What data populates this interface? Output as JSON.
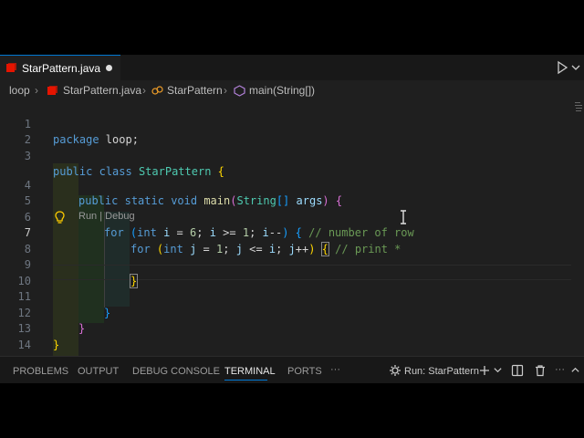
{
  "tab": {
    "filename": "StarPattern.java"
  },
  "breadcrumb": {
    "folder": "loop",
    "file": "StarPattern.java",
    "class": "StarPattern",
    "method": "main(String[])"
  },
  "codelens": "Run | Debug",
  "line_numbers": [
    "1",
    "2",
    "3",
    "4",
    "5",
    "6",
    "7",
    "8",
    "9",
    "10",
    "11",
    "12",
    "13",
    "14"
  ],
  "code": {
    "l1_kw": "package",
    "l1_rest": " loop;",
    "l3_kw1": "public",
    "l3_kw2": "class",
    "l3_name": "StarPattern",
    "l3_brace": "{",
    "l4_kw1": "public",
    "l4_kw2": "static",
    "l4_kw3": "void",
    "l4_fn": "main",
    "l4_paren_open": "(",
    "l4_type": "String",
    "l4_arr": "[]",
    "l4_arg": "args",
    "l4_paren_close": ")",
    "l4_brace": "{",
    "l6_for": "for",
    "l6_open": "(",
    "l6_int": "int",
    "l6_i": "i",
    "l6_eq": " = ",
    "l6_6": "6",
    "l6_semi1": "; ",
    "l6_i2": "i",
    "l6_ge": " >= ",
    "l6_1": "1",
    "l6_semi2": "; ",
    "l6_i3": "i",
    "l6_dec": "--",
    "l6_close": ")",
    "l6_brace": "{",
    "l6_comment": "// number of row",
    "l7_for": "for",
    "l7_open": "(",
    "l7_int": "int",
    "l7_j": "j",
    "l7_eq": " = ",
    "l7_1": "1",
    "l7_semi1": "; ",
    "l7_j2": "j",
    "l7_le": " <= ",
    "l7_i": "i",
    "l7_semi2": "; ",
    "l7_j3": "j",
    "l7_inc": "++",
    "l7_close": ")",
    "l7_brace": "{",
    "l7_comment": "// print *",
    "l9_brace": "}",
    "l11_brace": "}",
    "l12_brace": "}",
    "l13_brace": "}"
  },
  "panel": {
    "problems": "PROBLEMS",
    "output": "OUTPUT",
    "debug_console": "DEBUG CONSOLE",
    "terminal": "TERMINAL",
    "ports": "PORTS",
    "more": "···",
    "run_config": "Run: StarPattern"
  },
  "colors": {
    "accent": "#0078d4",
    "java_icon": "#e51400",
    "keyword": "#569cd6",
    "type": "#4ec9b0",
    "function": "#dcdcaa",
    "variable": "#9cdcfe",
    "number": "#b5cea8",
    "comment": "#6a9955"
  }
}
